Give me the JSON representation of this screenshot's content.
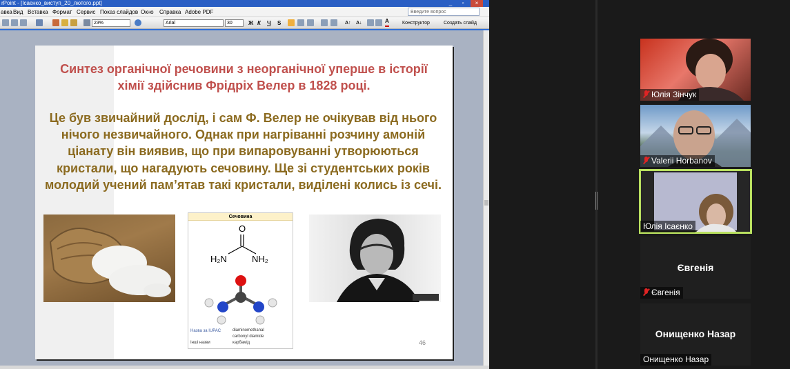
{
  "ppt": {
    "title": "rPoint - [Ісаєнко_виступ_20_лютого.ppt]",
    "menu": [
      "авка",
      "Вид",
      "Вставка",
      "Формат",
      "Сервис",
      "Показ слайдов",
      "Окно",
      "Справка",
      "Adobe PDF"
    ],
    "help_placeholder": "Введите вопрос",
    "toolbar": {
      "zoom": "23%",
      "font": "Arial",
      "font_size": "30",
      "designer": "Конструктор",
      "new_slide": "Создать слайд"
    },
    "slide": {
      "title": "Синтез органічної речовини з неорганічної уперше в історії хімії здійснив Фрідріх Велер в 1828 році.",
      "body": "Це був звичайний дослід, і сам Ф. Велер не очікував від нього нічого незвичайного. Однак при нагріванні розчину амоній ціанату він виявив, що при випаровуванні утворюються кристали, що нагадують сечовину. Ще зі студентських років молодий учений пам’ятав такі кристали, виділені колись із сечі.",
      "number": "46",
      "infobox": {
        "header": "Сечовина",
        "iupac_label": "Назва за IUPAC",
        "iupac_value_1": "diaminomethanal",
        "iupac_value_2": "carbonyl diamide",
        "other_label": "Інші назви",
        "other_value": "карбамід"
      }
    }
  },
  "participants": [
    {
      "name": "Юлія Зінчук",
      "muted": true
    },
    {
      "name": "Valerii Horbanov",
      "muted": true
    },
    {
      "name": "Юлія Ісаєнко",
      "muted": false,
      "active": true
    },
    {
      "name": "Євгенія",
      "muted": true,
      "avatar_text": "Євгенія"
    },
    {
      "name": "Онищенко Назар",
      "muted": false,
      "avatar_text": "Онищенко Назар"
    }
  ]
}
